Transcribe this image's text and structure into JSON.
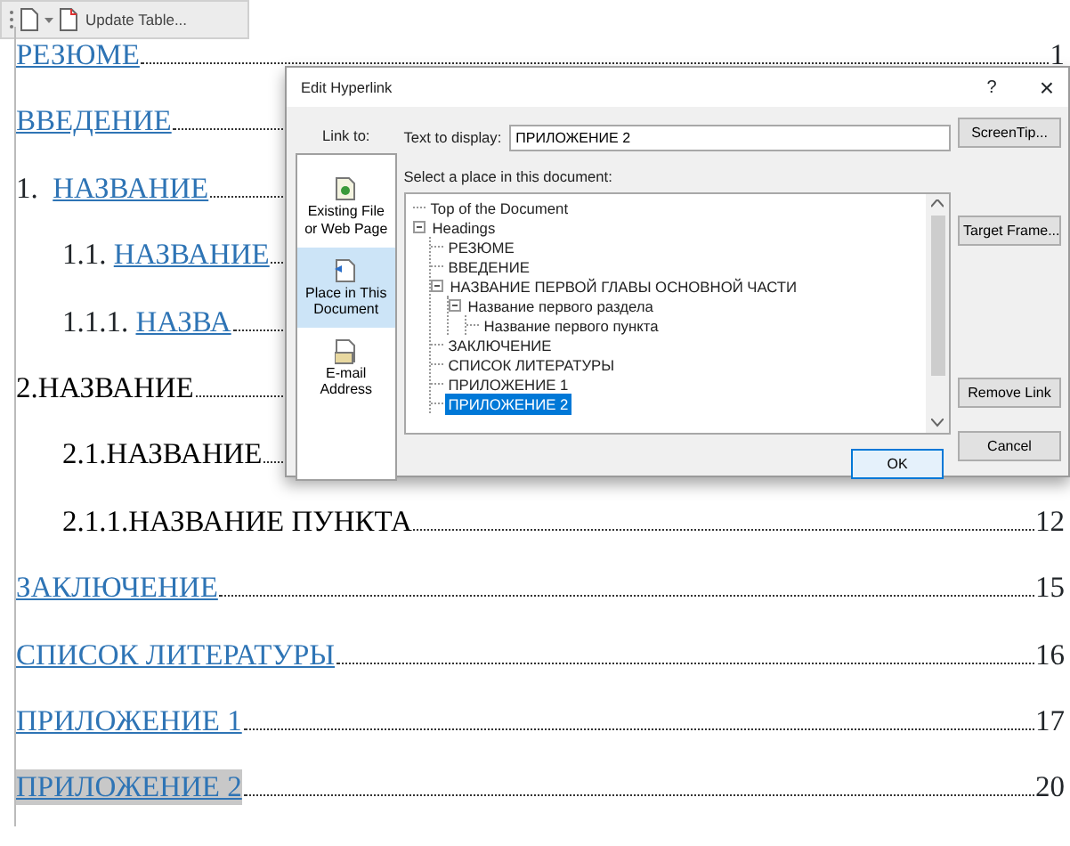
{
  "toolbar": {
    "button": "Update Table..."
  },
  "toc": [
    {
      "text": "РЕЗЮМЕ",
      "linked": true,
      "highlighted": false,
      "page": "1"
    },
    {
      "text": "ВВЕДЕНИЕ",
      "linked": true,
      "highlighted": false
    },
    {
      "text": "1.  ",
      "link_text": "НАЗВАНИЕ",
      "linked": true,
      "highlighted": false,
      "children": [
        {
          "text": "1.1. ",
          "link_text": "НАЗВАНИЕ",
          "linked": true,
          "highlighted": false,
          "children": [
            {
              "text": "1.1.1. ",
              "link_text": "НАЗВА",
              "linked": true,
              "highlighted": false
            }
          ]
        }
      ]
    },
    {
      "text": "2.НАЗВАНИЕ",
      "linked": false,
      "highlighted": false,
      "children": [
        {
          "text": "2.1.НАЗВАНИЕ",
          "linked": false,
          "highlighted": false,
          "children": [
            {
              "text": "2.1.1.НАЗВАНИЕ ПУНКТА",
              "linked": false,
              "highlighted": false,
              "page": "12"
            }
          ]
        }
      ]
    },
    {
      "text": "ЗАКЛЮЧЕНИЕ",
      "linked": true,
      "highlighted": false,
      "page": "15"
    },
    {
      "text": "СПИСОК ЛИТЕРАТУРЫ",
      "linked": true,
      "highlighted": false,
      "page": "16"
    },
    {
      "text": "ПРИЛОЖЕНИЕ 1",
      "linked": true,
      "highlighted": false,
      "page": "17"
    },
    {
      "text": "ПРИЛОЖЕНИЕ 2",
      "linked": true,
      "highlighted": true,
      "page": "20"
    }
  ],
  "dialog": {
    "title": "Edit Hyperlink",
    "help": "?",
    "close": "×",
    "link_to_label": "Link to:",
    "link_to": [
      {
        "label": "Existing File or Web Page",
        "selected": false
      },
      {
        "label": "Place in This Document",
        "selected": true
      },
      {
        "label": "E-mail Address",
        "selected": false
      }
    ],
    "text_to_display_label": "Text to display:",
    "text_to_display": "ПРИЛОЖЕНИЕ 2",
    "screentip_button": "ScreenTip...",
    "place_label": "Select a place in this document:",
    "tree": [
      {
        "label": "Top of the Document",
        "selected": false
      },
      {
        "label": "Headings",
        "selected": false,
        "expanded": true,
        "children": [
          {
            "label": "РЕЗЮМЕ",
            "selected": false
          },
          {
            "label": "ВВЕДЕНИЕ",
            "selected": false
          },
          {
            "label": "НАЗВАНИЕ ПЕРВОЙ ГЛАВЫ ОСНОВНОЙ ЧАСТИ",
            "selected": false,
            "expanded": true,
            "children": [
              {
                "label": "Название первого раздела",
                "selected": false,
                "expanded": true,
                "children": [
                  {
                    "label": "Название первого пункта",
                    "selected": false
                  }
                ]
              }
            ]
          },
          {
            "label": "ЗАКЛЮЧЕНИЕ",
            "selected": false
          },
          {
            "label": "СПИСОК ЛИТЕРАТУРЫ",
            "selected": false
          },
          {
            "label": "ПРИЛОЖЕНИЕ 1",
            "selected": false
          },
          {
            "label": "ПРИЛОЖЕНИЕ 2",
            "selected": true
          }
        ]
      }
    ],
    "target_frame_button": "Target Frame...",
    "remove_link_button": "Remove Link",
    "ok_button": "OK",
    "cancel_button": "Cancel"
  }
}
